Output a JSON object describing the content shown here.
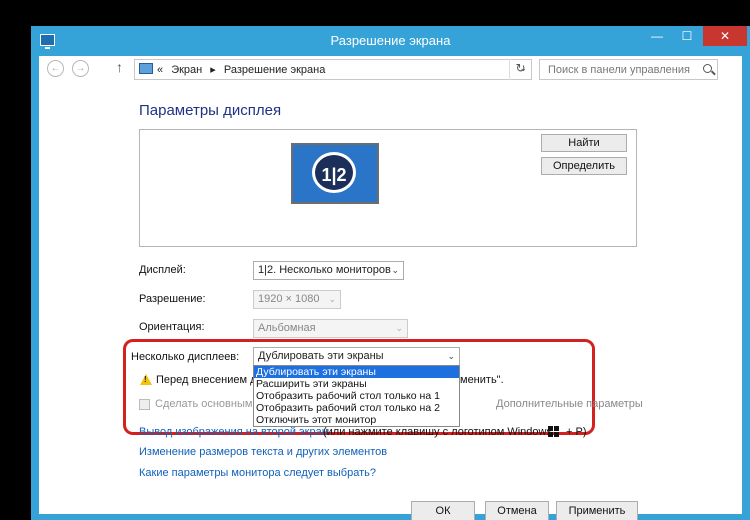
{
  "window": {
    "title": "Разрешение экрана",
    "controls": {
      "minimize": "—",
      "maximize": "☐",
      "close": "✕"
    }
  },
  "addressbar": {
    "back": "←",
    "forward": "→",
    "up": "↑",
    "path": [
      "«",
      "Экран",
      "▸",
      "Разрешение экрана"
    ],
    "dropdown": "⌄",
    "refresh": "↻",
    "search_placeholder": "Поиск в панели управления"
  },
  "main": {
    "heading": "Параметры дисплея",
    "monitor_label": "1|2",
    "buttons": {
      "find": "Найти",
      "detect": "Определить"
    },
    "display": {
      "label": "Дисплей:",
      "value": "1|2. Несколько мониторов"
    },
    "resolution": {
      "label": "Разрешение:",
      "value": "1920 × 1080"
    },
    "orientation": {
      "label": "Ориентация:",
      "value": "Альбомная"
    },
    "multiple": {
      "label": "Несколько дисплеев:",
      "value": "Дублировать эти экраны",
      "options": [
        "Дублировать эти экраны",
        "Расширить эти экраны",
        "Отобразить рабочий стол только на 1",
        "Отобразить рабочий стол только на 2",
        "Отключить этот монитор"
      ]
    },
    "warning": {
      "text": "Перед внесением д",
      "tail": "менить\"."
    },
    "make_primary": "Сделать основным д",
    "advanced_link": "Дополнительные параметры",
    "links": {
      "projector": "Вывод изображения на второй экран",
      "projector_rest": "(или нажмите клавишу с логотипом Windows",
      "projector_tail": "+ P)",
      "text_size": "Изменение размеров текста и других элементов",
      "which_settings": "Какие параметры монитора следует выбрать?"
    },
    "footer": {
      "ok": "ОК",
      "cancel": "Отмена",
      "apply": "Применить"
    }
  },
  "colors": {
    "accent": "#36a3d8",
    "highlight": "#d52020",
    "link": "#1060b8",
    "selection": "#1e6fe0"
  }
}
